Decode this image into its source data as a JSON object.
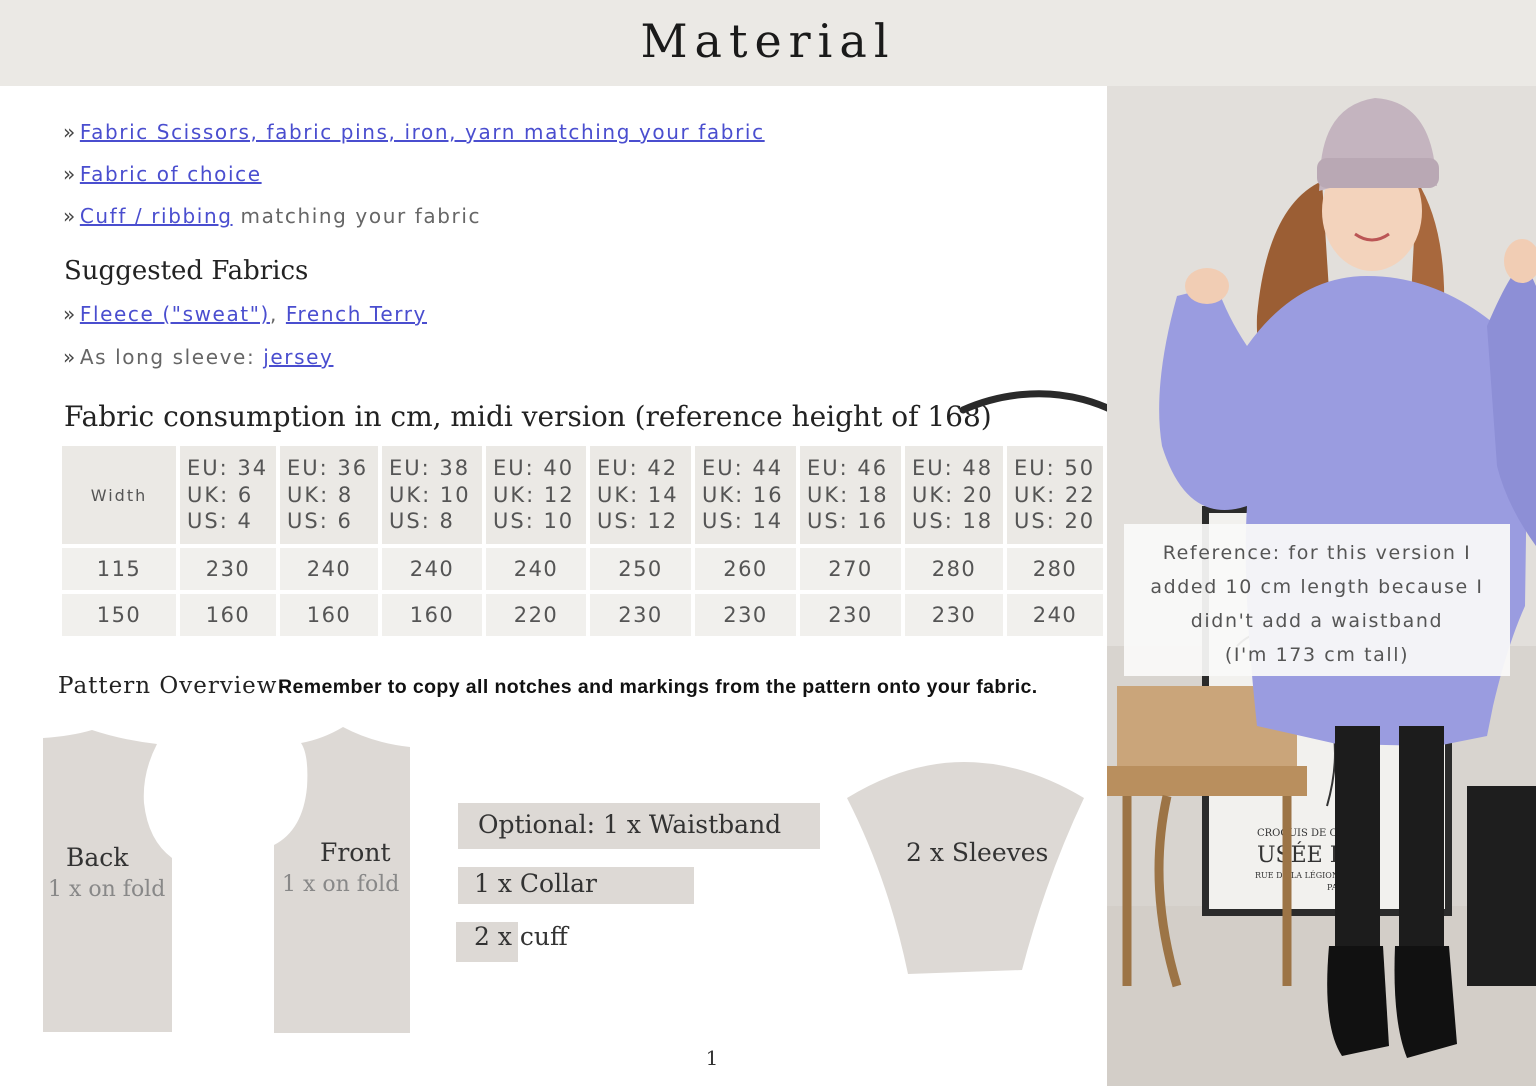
{
  "header": {
    "title": "Material"
  },
  "materials": [
    {
      "link": "Fabric Scissors, fabric pins, iron, yarn matching your fabric",
      "rest": ""
    },
    {
      "link": "Fabric of choice",
      "rest": ""
    },
    {
      "link": "Cuff / ribbing",
      "rest": " matching your fabric"
    }
  ],
  "suggested": {
    "heading": "Suggested Fabrics",
    "line1": {
      "link_a": "Fleece (\"sweat\")",
      "sep": ", ",
      "link_b": "French Terry"
    },
    "line2": {
      "prefix": "As long sleeve: ",
      "link": "jersey"
    }
  },
  "consumption": {
    "heading": "Fabric consumption in cm, midi version (reference height of 168)",
    "width_label": "Width",
    "sizes": [
      {
        "eu": "EU: 34",
        "uk": "UK: 6",
        "us": "US: 4"
      },
      {
        "eu": "EU: 36",
        "uk": "UK: 8",
        "us": "US: 6"
      },
      {
        "eu": "EU: 38",
        "uk": "UK: 10",
        "us": "US: 8"
      },
      {
        "eu": "EU: 40",
        "uk": "UK: 12",
        "us": "US: 10"
      },
      {
        "eu": "EU: 42",
        "uk": "UK: 14",
        "us": "US: 12"
      },
      {
        "eu": "EU: 44",
        "uk": "UK: 16",
        "us": "US: 14"
      },
      {
        "eu": "EU: 46",
        "uk": "UK: 18",
        "us": "US: 16"
      },
      {
        "eu": "EU: 48",
        "uk": "UK: 20",
        "us": "US: 18"
      },
      {
        "eu": "EU: 50",
        "uk": "UK: 22",
        "us": "US: 20"
      }
    ],
    "rows": [
      {
        "width": "115",
        "values": [
          "230",
          "240",
          "240",
          "240",
          "250",
          "260",
          "270",
          "280",
          "280"
        ]
      },
      {
        "width": "150",
        "values": [
          "160",
          "160",
          "160",
          "220",
          "230",
          "230",
          "230",
          "230",
          "240"
        ]
      }
    ]
  },
  "pattern": {
    "heading": "Pattern Overview:",
    "note": "Remember to copy all notches and markings from the pattern onto your fabric.",
    "back": {
      "label": "Back",
      "sub": "1 x on fold"
    },
    "front": {
      "label": "Front",
      "sub": "1 x on fold"
    },
    "waistband": "Optional: 1 x Waistband",
    "collar": "1 x Collar",
    "cuff": "2 x cuff",
    "sleeves": "2 x Sleeves"
  },
  "reference": {
    "lines": [
      "Reference: for this version I",
      "added 10 cm length because I",
      "didn't add a waistband",
      "(I'm 173 cm tall)"
    ]
  },
  "photo": {
    "poster_line1": "CROQUIS DE COL",
    "poster_line2": "USÉE D",
    "poster_line3": "RUE DE LA LÉGION",
    "poster_line4": "PARIS"
  },
  "footer": {
    "page_number": "1"
  },
  "colors": {
    "header_bg": "#ebe9e5",
    "link": "#4a4ecf",
    "cell_bg": "#ebe9e5",
    "piece_bg": "#ddd9d5",
    "sweater": "#9a9ce0"
  }
}
